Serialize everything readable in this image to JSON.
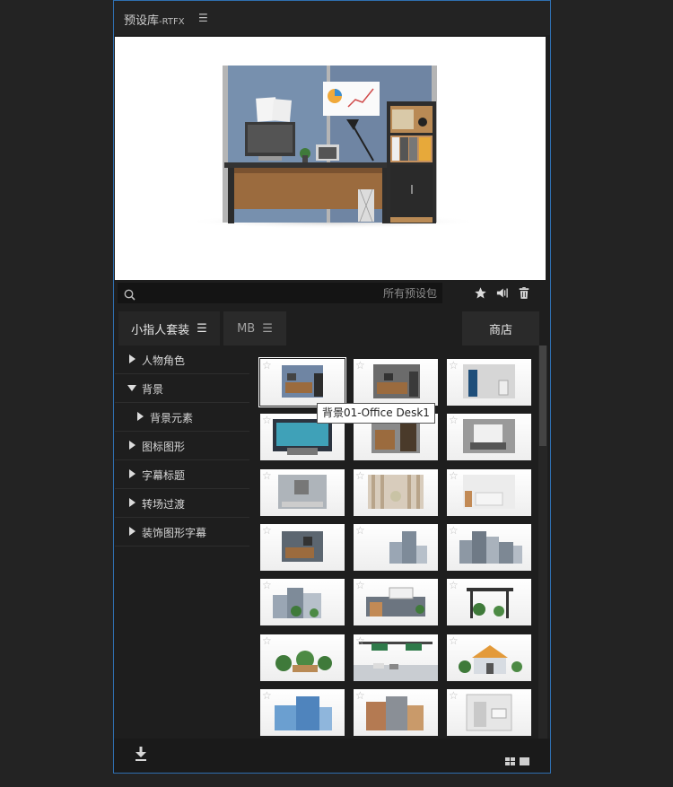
{
  "header": {
    "title": "预设库",
    "subtitle": "-RTFX",
    "menu_icon": "hamburger-icon"
  },
  "search": {
    "placeholder": "所有预设包",
    "value": ""
  },
  "toolbar": {
    "icons": [
      "star-icon",
      "audio-icon",
      "trash-icon"
    ]
  },
  "tabs": [
    {
      "label": "小指人套装",
      "active": true
    },
    {
      "label": "MB",
      "active": false
    }
  ],
  "store": {
    "label": "商店"
  },
  "sidebar": {
    "categories": [
      {
        "label": "人物角色",
        "expanded": false
      },
      {
        "label": "背景",
        "expanded": true
      },
      {
        "label": "背景元素",
        "expanded": false,
        "child": true
      },
      {
        "label": "图标图形",
        "expanded": false
      },
      {
        "label": "字幕标题",
        "expanded": false
      },
      {
        "label": "转场过渡",
        "expanded": false
      },
      {
        "label": "装饰图形字幕",
        "expanded": false
      }
    ]
  },
  "tooltip": {
    "text": "背景01-Office Desk1"
  },
  "colors": {
    "accent_border": "#2f6fb0",
    "panel_bg": "#1e1e1e",
    "header_bg": "#232323"
  },
  "footer": {
    "icons": [
      "download-icon",
      "grid-view-icon",
      "list-view-icon"
    ]
  }
}
